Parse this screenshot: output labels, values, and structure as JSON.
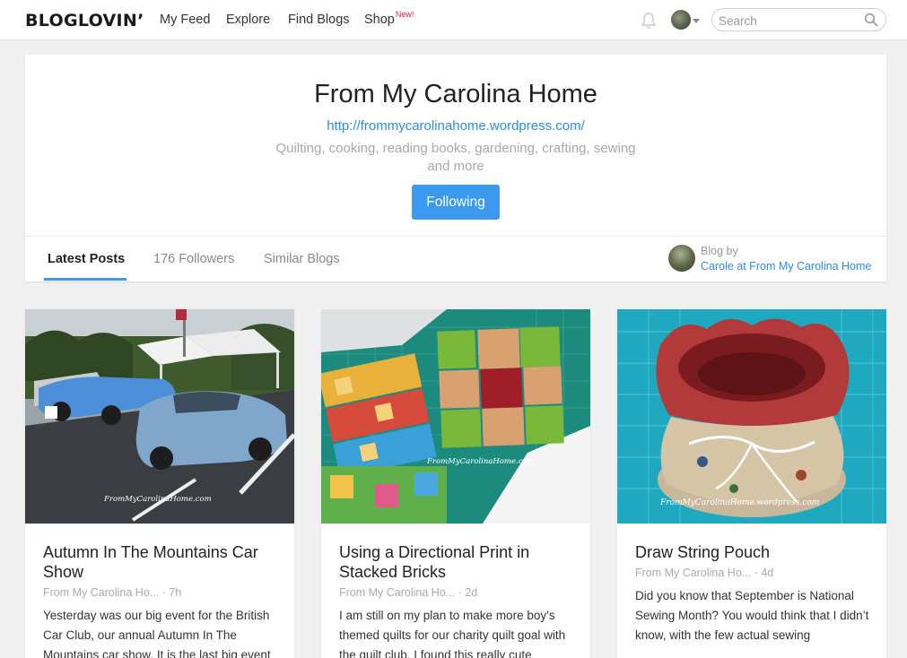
{
  "nav": {
    "logo": "BLOGLOVIN’",
    "links": [
      "My Feed",
      "Explore",
      "Find Blogs",
      "Shop"
    ],
    "shop_badge": "New!",
    "search_placeholder": "Search"
  },
  "blog": {
    "title": "From My Carolina Home",
    "url": "http://frommycarolinahome.wordpress.com/",
    "description": "Quilting, cooking, reading books, gardening, crafting, sewing and more",
    "follow_label": "Following"
  },
  "tabs": [
    "Latest Posts",
    "176 Followers",
    "Similar Blogs"
  ],
  "author": {
    "blog_by": "Blog by",
    "name": "Carole at From My Carolina Home"
  },
  "posts": [
    {
      "title": "Autumn In The Mountains Car Show",
      "source": "From My Carolina Ho...",
      "age": "· 7h",
      "excerpt": "Yesterday was our big event for the British Car Club, our annual Autumn In The Mountains car show. It is the last big event",
      "watermark": "FromMyCarolinaHome.com"
    },
    {
      "title": "Using a Directional Print in Stacked Bricks",
      "source": "From My Carolina Ho...",
      "age": "· 2d",
      "excerpt": "I am still on my plan to make more boy’s themed quilts for our charity quilt goal with the quilt club. I found this really cute",
      "watermark": "FromMyCarolinaHome.com"
    },
    {
      "title": "Draw String Pouch",
      "source": "From My Carolina Ho...",
      "age": "· 4d",
      "excerpt": "Did you know that September is National Sewing Month? You would think that I didn’t know, with the few actual sewing",
      "watermark": "FromMyCarolinaHome.wordpress.com"
    }
  ]
}
